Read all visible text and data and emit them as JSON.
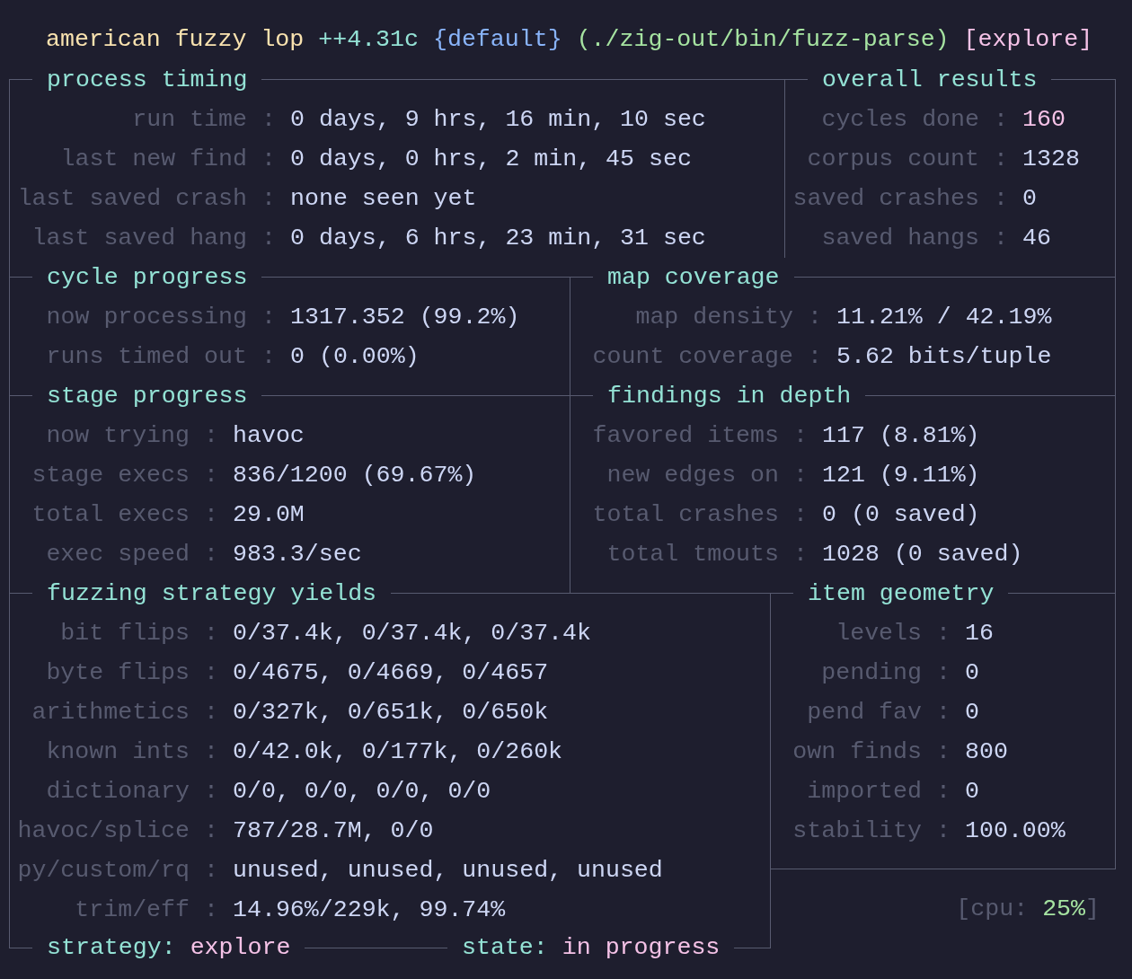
{
  "header": {
    "name": "american fuzzy lop",
    "version": "++4.31c",
    "instance": "{default}",
    "target": "(./zig-out/bin/fuzz-parse)",
    "mode": "[explore]"
  },
  "separator": ":",
  "process_timing": {
    "title": "process timing",
    "rows": [
      {
        "label": "run time",
        "value": "0 days, 9 hrs, 16 min, 10 sec"
      },
      {
        "label": "last new find",
        "value": "0 days, 0 hrs, 2 min, 45 sec"
      },
      {
        "label": "last saved crash",
        "value": "none seen yet"
      },
      {
        "label": "last saved hang",
        "value": "0 days, 6 hrs, 23 min, 31 sec"
      }
    ]
  },
  "overall_results": {
    "title": "overall results",
    "rows": [
      {
        "label": "cycles done",
        "value": "160",
        "color": "#f5c2e7"
      },
      {
        "label": "corpus count",
        "value": "1328",
        "color": "#cdd6f4"
      },
      {
        "label": "saved crashes",
        "value": "0",
        "color": "#cdd6f4"
      },
      {
        "label": "saved hangs",
        "value": "46",
        "color": "#cdd6f4"
      }
    ]
  },
  "cycle_progress": {
    "title": "cycle progress",
    "rows": [
      {
        "label": "now processing",
        "value": "1317.352 (99.2%)"
      },
      {
        "label": "runs timed out",
        "value": "0 (0.00%)"
      }
    ]
  },
  "map_coverage": {
    "title": "map coverage",
    "rows": [
      {
        "label": "map density",
        "value": "11.21% / 42.19%"
      },
      {
        "label": "count coverage",
        "value": "5.62 bits/tuple"
      }
    ]
  },
  "stage_progress": {
    "title": "stage progress",
    "rows": [
      {
        "label": "now trying",
        "value": "havoc"
      },
      {
        "label": "stage execs",
        "value": "836/1200 (69.67%)"
      },
      {
        "label": "total execs",
        "value": "29.0M"
      },
      {
        "label": "exec speed",
        "value": "983.3/sec"
      }
    ]
  },
  "findings_in_depth": {
    "title": "findings in depth",
    "rows": [
      {
        "label": "favored items",
        "value": "117 (8.81%)"
      },
      {
        "label": "new edges on",
        "value": "121 (9.11%)"
      },
      {
        "label": "total crashes",
        "value": "0 (0 saved)"
      },
      {
        "label": "total tmouts",
        "value": "1028 (0 saved)"
      }
    ]
  },
  "fuzzing_strategy_yields": {
    "title": "fuzzing strategy yields",
    "rows": [
      {
        "label": "bit flips",
        "value": "0/37.4k, 0/37.4k, 0/37.4k"
      },
      {
        "label": "byte flips",
        "value": "0/4675, 0/4669, 0/4657"
      },
      {
        "label": "arithmetics",
        "value": "0/327k, 0/651k, 0/650k"
      },
      {
        "label": "known ints",
        "value": "0/42.0k, 0/177k, 0/260k"
      },
      {
        "label": "dictionary",
        "value": "0/0, 0/0, 0/0, 0/0"
      },
      {
        "label": "havoc/splice",
        "value": "787/28.7M, 0/0"
      },
      {
        "label": "py/custom/rq",
        "value": "unused, unused, unused, unused"
      },
      {
        "label": "trim/eff",
        "value": "14.96%/229k, 99.74%"
      }
    ]
  },
  "item_geometry": {
    "title": "item geometry",
    "rows": [
      {
        "label": "levels",
        "value": "16"
      },
      {
        "label": "pending",
        "value": "0"
      },
      {
        "label": "pend fav",
        "value": "0"
      },
      {
        "label": "own finds",
        "value": "800"
      },
      {
        "label": "imported",
        "value": "0"
      },
      {
        "label": "stability",
        "value": "100.00%"
      }
    ]
  },
  "cpu": {
    "label": "[cpu:",
    "value": "25%",
    "suffix": "]"
  },
  "strategy": {
    "label": "strategy:",
    "value": "explore"
  },
  "state": {
    "label": "state:",
    "value": "in progress"
  }
}
